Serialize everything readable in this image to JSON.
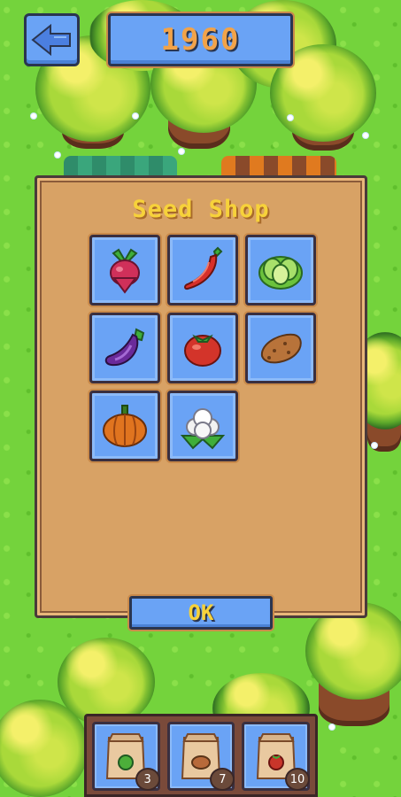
{
  "header": {
    "back_button": "back",
    "year": "1960"
  },
  "shop": {
    "title": "Seed Shop",
    "items": [
      {
        "name": "beet",
        "icon": "beet-icon"
      },
      {
        "name": "chili pepper",
        "icon": "chili-pepper-icon"
      },
      {
        "name": "lettuce",
        "icon": "lettuce-icon"
      },
      {
        "name": "eggplant",
        "icon": "eggplant-icon"
      },
      {
        "name": "tomato",
        "icon": "tomato-icon"
      },
      {
        "name": "potato",
        "icon": "potato-icon"
      },
      {
        "name": "pumpkin",
        "icon": "pumpkin-icon"
      },
      {
        "name": "cauliflower",
        "icon": "cauliflower-icon"
      }
    ],
    "ok_label": "OK"
  },
  "inventory": {
    "slots": [
      {
        "icon": "lettuce-seed-packet-icon",
        "count": "3",
        "seed_color": "#4caf3a"
      },
      {
        "icon": "potato-seed-packet-icon",
        "count": "7",
        "seed_color": "#b86a3a"
      },
      {
        "icon": "tomato-seed-packet-icon",
        "count": "10",
        "seed_color": "#c8352a"
      }
    ]
  },
  "colors": {
    "button_blue": "#6aa3f5",
    "panel_tan": "#d8a265",
    "title_yellow": "#f7d23a",
    "year_orange": "#f2a349",
    "grass": "#74d33c"
  }
}
